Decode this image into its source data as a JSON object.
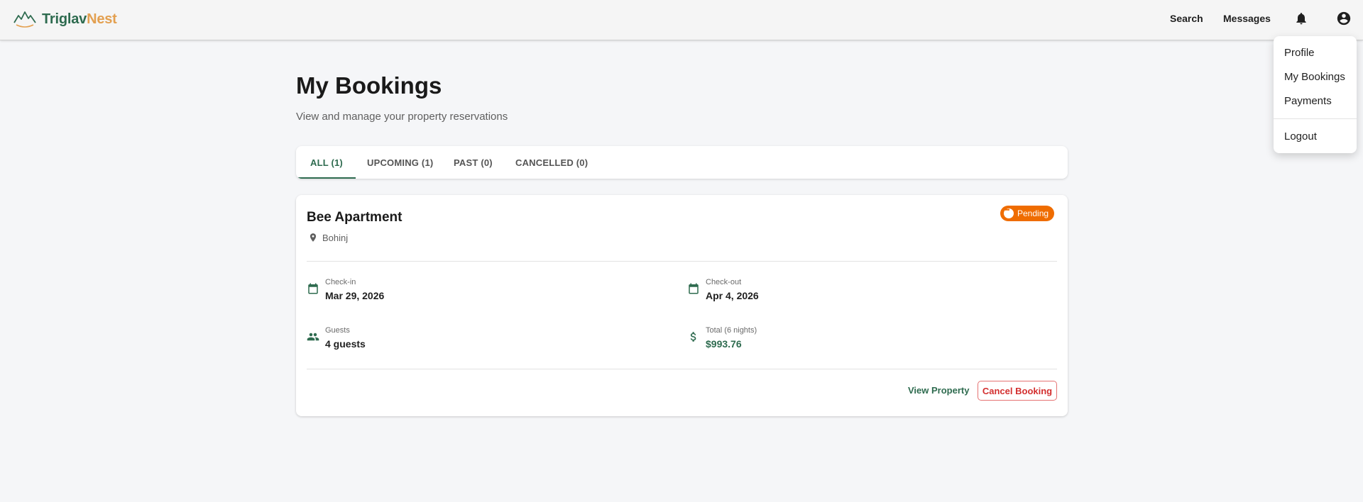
{
  "header": {
    "brand_part1": "Triglav",
    "brand_part2": "Nest",
    "nav_search": "Search",
    "nav_messages": "Messages"
  },
  "user_menu": {
    "items": [
      "Profile",
      "My Bookings",
      "Payments"
    ],
    "logout": "Logout"
  },
  "page": {
    "title": "My Bookings",
    "subtitle": "View and manage your property reservations"
  },
  "tabs": [
    {
      "label": "ALL (1)",
      "active": true
    },
    {
      "label": "UPCOMING (1)",
      "active": false
    },
    {
      "label": "PAST (0)",
      "active": false
    },
    {
      "label": "CANCELLED (0)",
      "active": false
    }
  ],
  "booking": {
    "property_name": "Bee Apartment",
    "location": "Bohinj",
    "status": "Pending",
    "checkin_label": "Check-in",
    "checkin_value": "Mar 29, 2026",
    "checkout_label": "Check-out",
    "checkout_value": "Apr 4, 2026",
    "guests_label": "Guests",
    "guests_value": "4 guests",
    "total_label": "Total (6 nights)",
    "total_value": "$993.76",
    "view_property_label": "View Property",
    "cancel_label": "Cancel Booking"
  },
  "colors": {
    "brand_green": "#2e6b4f",
    "brand_orange": "#e3a050",
    "status_pending": "#ef6c00",
    "danger": "#d32f2f"
  }
}
